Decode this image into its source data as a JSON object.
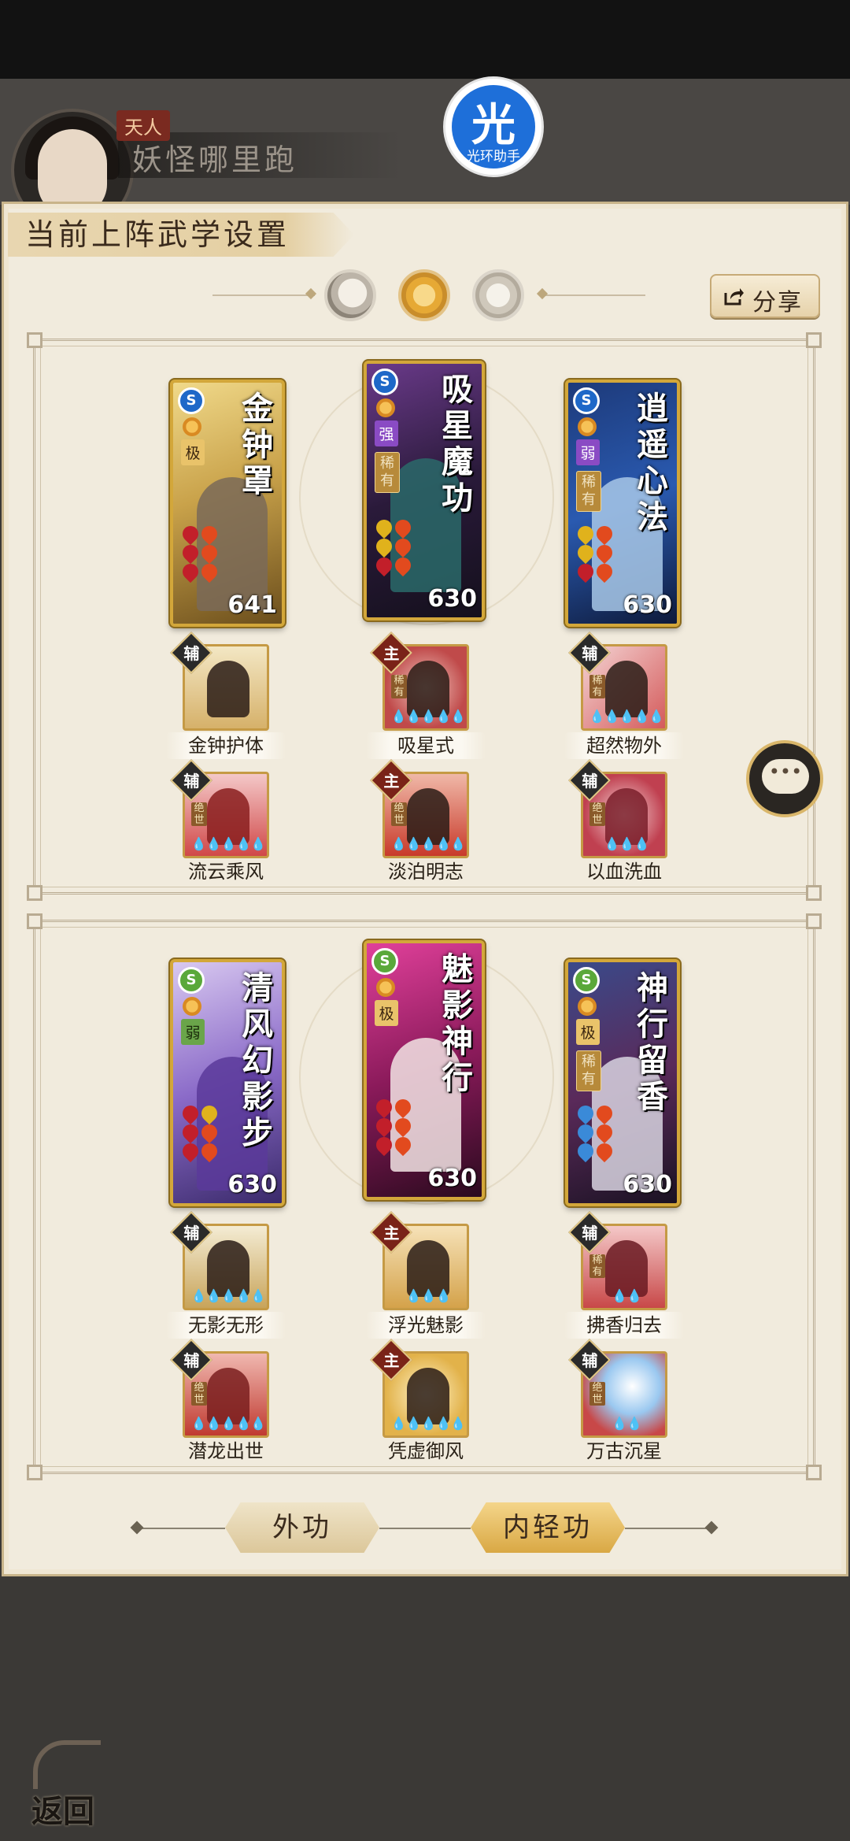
{
  "header": {
    "rank": "天人",
    "player_name": "妖怪哪里跑"
  },
  "watermark": {
    "char": "光",
    "text": "光环助手"
  },
  "panel": {
    "title": "当前上阵武学设置",
    "share_label": "分享"
  },
  "loadouts": [
    {
      "cards": [
        {
          "title": "金钟罩",
          "badge": "S",
          "tier": "极",
          "rare": "",
          "power": "641",
          "theme": "gold"
        },
        {
          "title": "吸星魔功",
          "badge": "S",
          "tier": "强",
          "rare": "稀有",
          "power": "630",
          "theme": "purple"
        },
        {
          "title": "逍遥心法",
          "badge": "S",
          "tier": "弱",
          "rare": "稀有",
          "power": "630",
          "theme": "blue"
        }
      ],
      "skills": [
        {
          "tag": "辅",
          "name": "金钟护体",
          "rare": "",
          "gems": ""
        },
        {
          "tag": "主",
          "name": "吸星式",
          "rare": "稀有",
          "gems": "💧💧💧💧💧"
        },
        {
          "tag": "辅",
          "name": "超然物外",
          "rare": "稀有",
          "gems": "💧💧💧💧💧"
        },
        {
          "tag": "辅",
          "name": "流云乘风",
          "rare": "绝世",
          "gems": "💧💧💧💧💧"
        },
        {
          "tag": "主",
          "name": "淡泊明志",
          "rare": "绝世",
          "gems": "💧💧💧💧💧"
        },
        {
          "tag": "辅",
          "name": "以血洗血",
          "rare": "绝世",
          "gems": "💧💧💧"
        }
      ]
    },
    {
      "cards": [
        {
          "title": "清风幻影步",
          "badge": "S",
          "tier": "弱",
          "rare": "",
          "power": "630",
          "theme": "violet"
        },
        {
          "title": "魅影神行",
          "badge": "S",
          "tier": "极",
          "rare": "",
          "power": "630",
          "theme": "magenta"
        },
        {
          "title": "神行留香",
          "badge": "S",
          "tier": "极",
          "rare": "稀有",
          "power": "630",
          "theme": "darkblue"
        }
      ],
      "skills": [
        {
          "tag": "辅",
          "name": "无影无形",
          "rare": "",
          "gems": "💧💧💧💧💧"
        },
        {
          "tag": "主",
          "name": "浮光魅影",
          "rare": "",
          "gems": "💧💧💧"
        },
        {
          "tag": "辅",
          "name": "拂香归去",
          "rare": "稀有",
          "gems": "💧💧"
        },
        {
          "tag": "辅",
          "name": "潜龙出世",
          "rare": "绝世",
          "gems": "💧💧💧💧💧"
        },
        {
          "tag": "主",
          "name": "凭虚御风",
          "rare": "",
          "gems": "💧💧💧💧💧"
        },
        {
          "tag": "辅",
          "name": "万古沉星",
          "rare": "绝世",
          "gems": "💧💧"
        }
      ]
    }
  ],
  "tabs": {
    "external": "外功",
    "internal": "内轻功",
    "active": "内轻功"
  },
  "back_label": "返回",
  "colors": {
    "frame": "#d3a73a",
    "panel": "#f1ebdd",
    "accent": "#d9a844"
  }
}
